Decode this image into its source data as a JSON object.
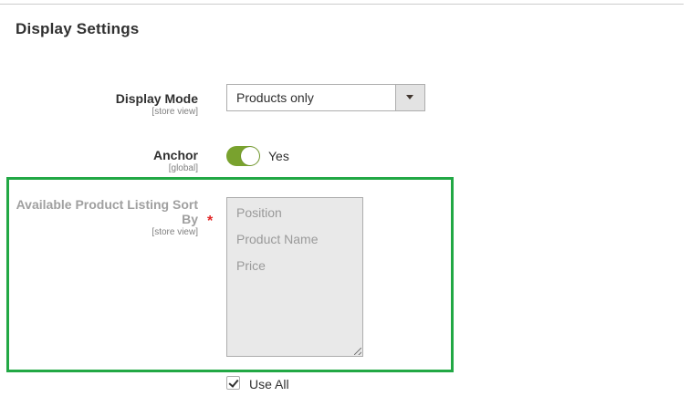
{
  "section": {
    "title": "Display Settings"
  },
  "fields": {
    "display_mode": {
      "label": "Display Mode",
      "scope": "[store view]",
      "value": "Products only"
    },
    "anchor": {
      "label": "Anchor",
      "scope": "[global]",
      "value_text": "Yes",
      "enabled": true
    },
    "sort_by": {
      "label_line1": "Available Product Listing Sort",
      "label_line2": "By",
      "scope": "[store view]",
      "required_mark": "*",
      "options": [
        "Position",
        "Product Name",
        "Price"
      ]
    },
    "use_all": {
      "label": "Use All",
      "checked": true
    }
  },
  "colors": {
    "highlight": "#22a845",
    "toggle_on": "#79a22e",
    "required": "#e22626"
  },
  "icons": {
    "select_arrow": "chevron-down-icon",
    "checkbox": "check-icon",
    "resize": "resize-grip-icon"
  }
}
